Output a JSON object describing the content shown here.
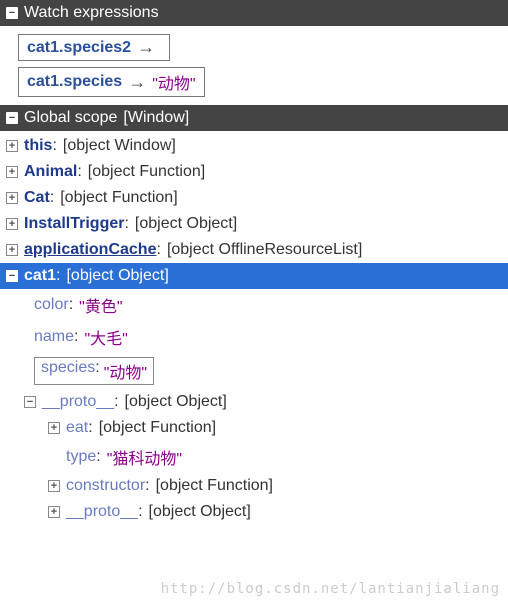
{
  "sections": {
    "watch": {
      "title": "Watch expressions"
    },
    "scope": {
      "title": "Global scope",
      "context": "[Window]"
    }
  },
  "watch": [
    {
      "expr": "cat1.species2",
      "value": ""
    },
    {
      "expr": "cat1.species",
      "value": "\"动物\""
    }
  ],
  "scope": {
    "this": {
      "name": "this",
      "value": "[object Window]"
    },
    "animal": {
      "name": "Animal",
      "value": "[object Function]"
    },
    "cat": {
      "name": "Cat",
      "value": "[object Function]"
    },
    "installTrigger": {
      "name": "InstallTrigger",
      "value": "[object Object]"
    },
    "appCache": {
      "name": "applicationCache",
      "value": "[object OfflineResourceList]"
    },
    "cat1": {
      "name": "cat1",
      "value": "[object Object]",
      "props": {
        "color": {
          "name": "color",
          "value": "\"黄色\""
        },
        "nm": {
          "name": "name",
          "value": "\"大毛\""
        },
        "species": {
          "name": "species",
          "value": "\"动物\""
        }
      },
      "proto": {
        "name": "__proto__",
        "value": "[object Object]",
        "eat": {
          "name": "eat",
          "value": "[object Function]"
        },
        "type": {
          "name": "type",
          "value": "\"猫科动物\""
        },
        "constructor": {
          "name": "constructor",
          "value": "[object Function]"
        },
        "protoInner": {
          "name": "__proto__",
          "value": "[object Object]"
        }
      }
    }
  },
  "icons": {
    "plus": "+",
    "minus": "−"
  },
  "watermark": "http://blog.csdn.net/lantianjialiang"
}
